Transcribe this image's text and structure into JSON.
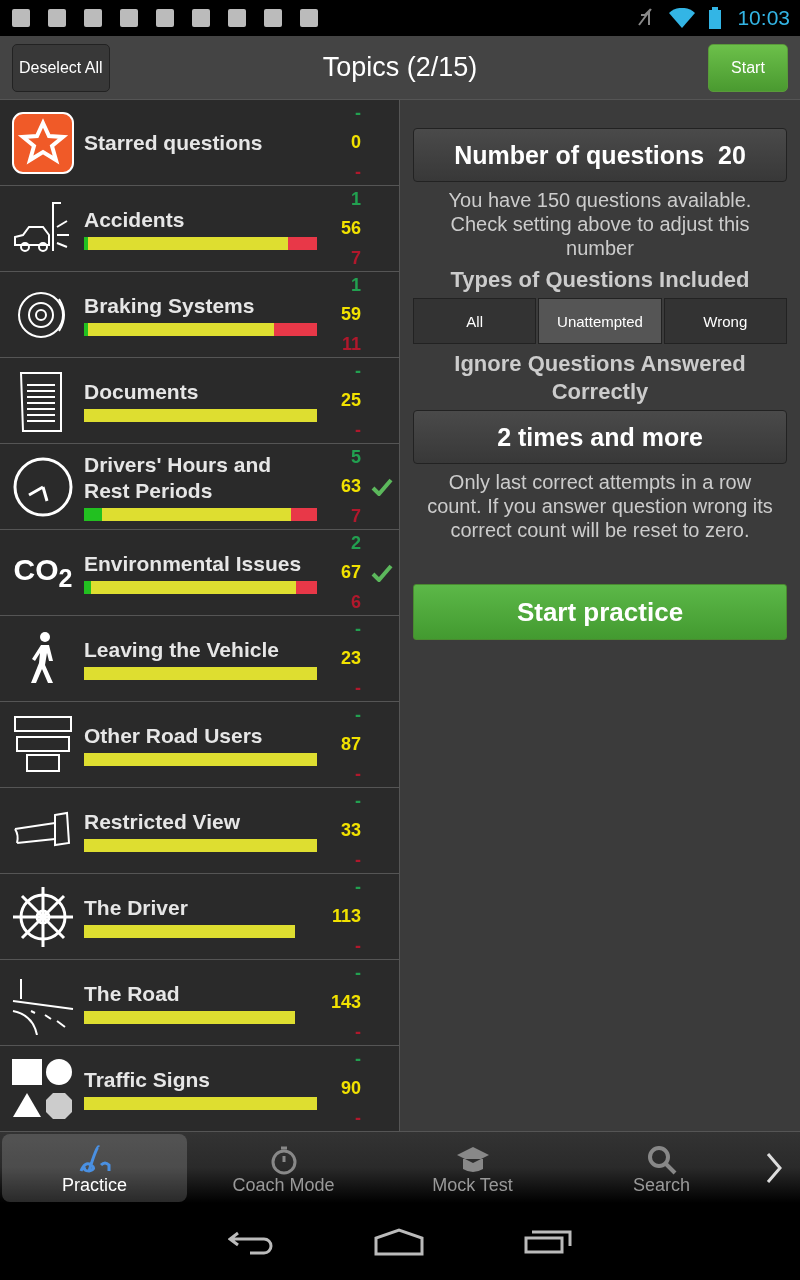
{
  "status_bar": {
    "time": "10:03"
  },
  "header": {
    "left_button": "Deselect All",
    "title": "Topics (2/15)",
    "right_button": "Start"
  },
  "topics": [
    {
      "kind": "starred",
      "name": "Starred questions",
      "correct": "-",
      "total": "0",
      "wrong": "-",
      "selected": false
    },
    {
      "kind": "topic",
      "name": "Accidents",
      "correct": "1",
      "total": "56",
      "wrong": "7",
      "selected": false
    },
    {
      "kind": "topic",
      "name": "Braking Systems",
      "correct": "1",
      "total": "59",
      "wrong": "11",
      "selected": false
    },
    {
      "kind": "topic",
      "name": "Documents",
      "correct": "-",
      "total": "25",
      "wrong": "-",
      "selected": false
    },
    {
      "kind": "topic",
      "name": "Drivers' Hours and Rest Periods",
      "correct": "5",
      "total": "63",
      "wrong": "7",
      "selected": true
    },
    {
      "kind": "topic",
      "name": "Environmental Issues",
      "correct": "2",
      "total": "67",
      "wrong": "6",
      "selected": true,
      "icon_text": "CO$_{2}$"
    },
    {
      "kind": "topic",
      "name": "Leaving the Vehicle",
      "correct": "-",
      "total": "23",
      "wrong": "-",
      "selected": false
    },
    {
      "kind": "topic",
      "name": "Other Road Users",
      "correct": "-",
      "total": "87",
      "wrong": "-",
      "selected": false
    },
    {
      "kind": "topic",
      "name": "Restricted View",
      "correct": "-",
      "total": "33",
      "wrong": "-",
      "selected": false
    },
    {
      "kind": "topic",
      "name": "The Driver",
      "correct": "-",
      "total": "113",
      "wrong": "-",
      "selected": false
    },
    {
      "kind": "topic",
      "name": "The Road",
      "correct": "-",
      "total": "143",
      "wrong": "-",
      "selected": false
    },
    {
      "kind": "topic",
      "name": "Traffic Signs",
      "correct": "-",
      "total": "90",
      "wrong": "-",
      "selected": false
    }
  ],
  "settings": {
    "count_button": "Number of questions  20",
    "count_note": "You have 150 questions available. Check setting above to adjust this number",
    "types_heading": "Types of Questions Included",
    "types": [
      {
        "label": "All",
        "selected": false
      },
      {
        "label": "Unattempted",
        "selected": true
      },
      {
        "label": "Wrong",
        "selected": false
      }
    ],
    "ignore_heading": "Ignore Questions Answered Correctly",
    "ignore_button": "2 times and more",
    "ignore_note": "Only last correct attempts in a row count. If you answer question wrong its correct count will be reset to zero.",
    "start_button": "Start practice"
  },
  "bottom_tabs": [
    {
      "label": "Practice",
      "selected": true
    },
    {
      "label": "Coach Mode",
      "selected": false
    },
    {
      "label": "Mock Test",
      "selected": false
    },
    {
      "label": "Search",
      "selected": false
    }
  ]
}
